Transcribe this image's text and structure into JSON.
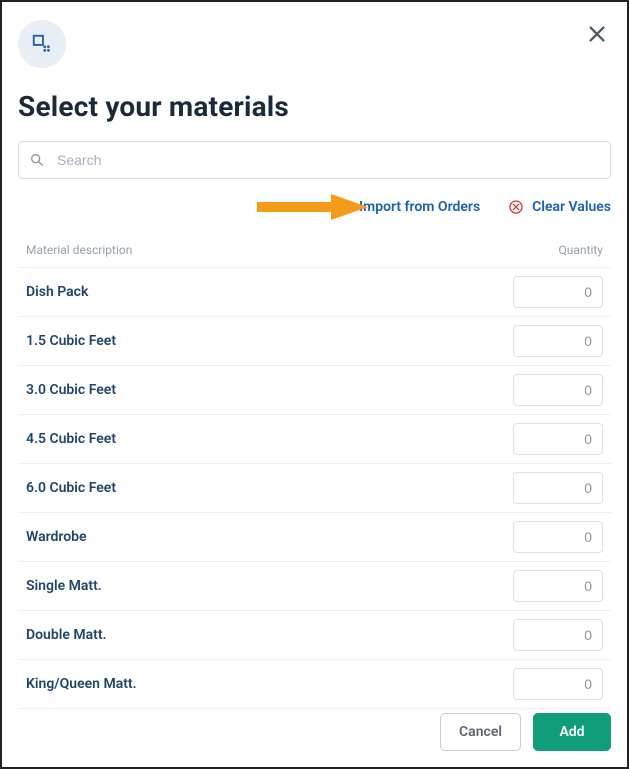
{
  "header": {
    "title": "Select your materials"
  },
  "search": {
    "placeholder": "Search"
  },
  "actions": {
    "import_label": "Import from Orders",
    "clear_label": "Clear Values"
  },
  "table": {
    "col_desc": "Material description",
    "col_qty": "Quantity",
    "rows": [
      {
        "desc": "Dish Pack",
        "qty": "0"
      },
      {
        "desc": "1.5 Cubic Feet",
        "qty": "0"
      },
      {
        "desc": "3.0 Cubic Feet",
        "qty": "0"
      },
      {
        "desc": "4.5 Cubic Feet",
        "qty": "0"
      },
      {
        "desc": "6.0 Cubic Feet",
        "qty": "0"
      },
      {
        "desc": "Wardrobe",
        "qty": "0"
      },
      {
        "desc": "Single Matt.",
        "qty": "0"
      },
      {
        "desc": "Double Matt.",
        "qty": "0"
      },
      {
        "desc": "King/Queen Matt.",
        "qty": "0"
      }
    ]
  },
  "footer": {
    "cancel_label": "Cancel",
    "add_label": "Add"
  }
}
